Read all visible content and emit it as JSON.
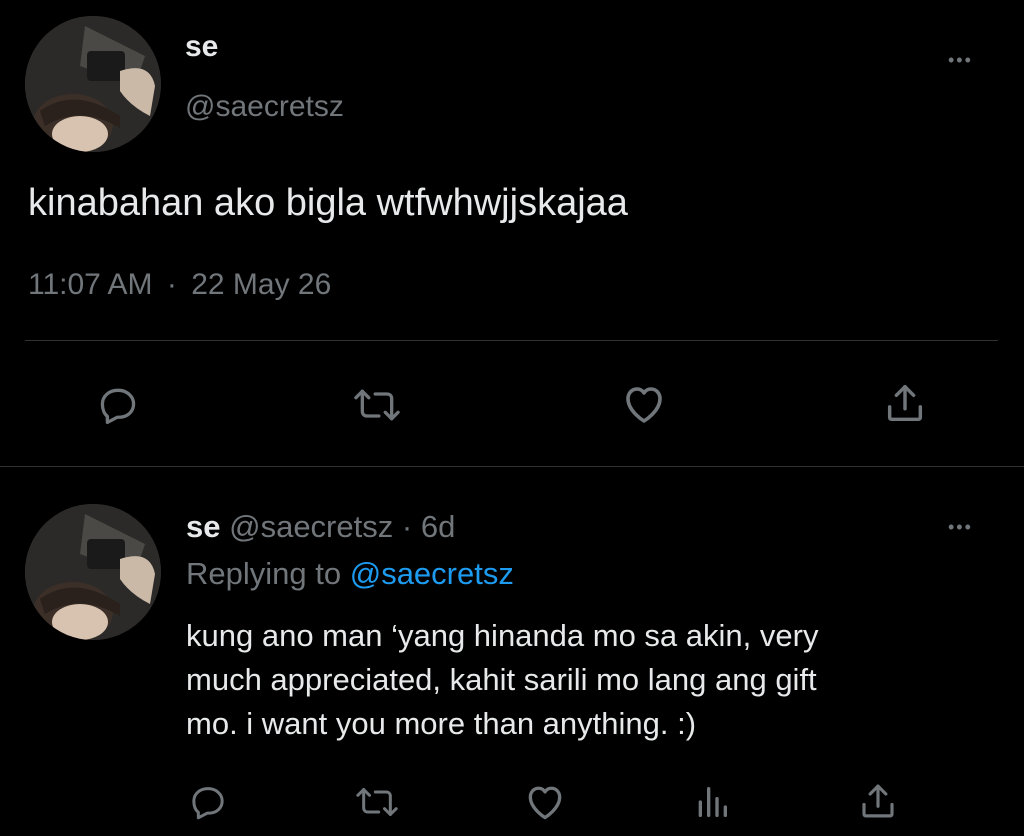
{
  "main_tweet": {
    "display_name": "se",
    "handle": "@saecretsz",
    "text": "kinabahan ako bigla wtfwhwjjskajaa",
    "time": "11:07 AM",
    "separator": "·",
    "date": "22 May 26",
    "more_label": "•••",
    "actions": [
      "reply-icon",
      "retweet-icon",
      "like-icon",
      "share-icon"
    ]
  },
  "reply_tweet": {
    "display_name": "se",
    "handle": "@saecretsz",
    "separator": "·",
    "age": "6d",
    "replying_to_label": "Replying to",
    "replying_to_handle": "@saecretsz",
    "text_line1": "kung ano man ‘yang hinanda mo sa akin, very",
    "text_line2": "much appreciated, kahit sarili mo lang ang gift",
    "text_line3": "mo. i want you more than anything. :)",
    "more_label": "•••",
    "actions": [
      "reply-icon",
      "retweet-icon",
      "like-icon",
      "analytics-icon",
      "share-icon"
    ]
  },
  "colors": {
    "background": "#000000",
    "text": "#e7e9ea",
    "muted": "#71767b",
    "link": "#1d9bf0",
    "divider": "#2f3336"
  }
}
